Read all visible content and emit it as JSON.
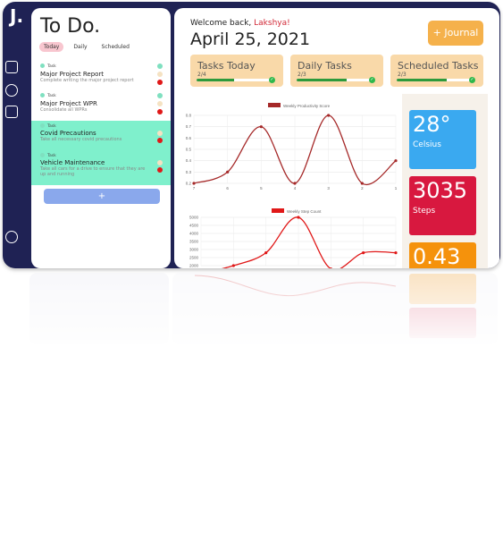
{
  "app": {
    "logo": "J."
  },
  "todo": {
    "title": "To Do.",
    "tabs": [
      {
        "label": "Today",
        "active": true
      },
      {
        "label": "Daily",
        "active": false
      },
      {
        "label": "Scheduled",
        "active": false
      }
    ],
    "tasks": [
      {
        "tag": "Task",
        "name": "Major Project Report",
        "desc": "Complete writing the major project report",
        "highlight": false
      },
      {
        "tag": "Task",
        "name": "Major Project WPR",
        "desc": "Consolidate all WPRs",
        "highlight": false
      },
      {
        "tag": "Task",
        "name": "Covid Precautions",
        "desc": "Take all necessary covid precautions",
        "highlight": true
      },
      {
        "tag": "Task",
        "name": "Vehicle Maintenance",
        "desc": "Take all cars for a drive to ensure that they are up and running",
        "highlight": true
      }
    ],
    "add_label": "+"
  },
  "header": {
    "welcome": "Welcome back, ",
    "user": "Lakshya!",
    "date": "April 25, 2021",
    "journal_label": "+ Journal"
  },
  "stats": [
    {
      "name": "Tasks Today",
      "count": "2/4",
      "progress": 0.5
    },
    {
      "name": "Daily Tasks",
      "count": "2/3",
      "progress": 0.67
    },
    {
      "name": "Scheduled Tasks",
      "count": "2/3",
      "progress": 0.67
    }
  ],
  "cards": [
    {
      "value": "28°",
      "unit": "Celsius",
      "color": "#3aa9f0"
    },
    {
      "value": "3035",
      "unit": "Steps",
      "color": "#d8183f"
    },
    {
      "value": "0.43",
      "unit": "",
      "color": "#f5920c"
    }
  ],
  "colors": {
    "accent_red": "#d12a38",
    "line_red": "#a52828",
    "task_highlight": "#7ff0cc"
  },
  "chart_data": [
    {
      "type": "line",
      "title": "",
      "legend": "Weekly Productivity Score",
      "x": [
        "7",
        "6",
        "5",
        "4",
        "3",
        "2",
        "1"
      ],
      "values": [
        0.2,
        0.3,
        0.7,
        0.2,
        0.8,
        0.2,
        0.4
      ],
      "ylim": [
        0.2,
        0.8
      ],
      "yticks": [
        "0.8",
        "0.7",
        "0.6",
        "0.5",
        "0.4",
        "0.3",
        "0.2"
      ]
    },
    {
      "type": "line",
      "title": "",
      "legend": "Weekly Step Count",
      "x": [
        "7",
        "6",
        "5",
        "4",
        "3",
        "2",
        "1"
      ],
      "values": [
        1500,
        2000,
        2800,
        5000,
        1800,
        2800,
        2800
      ],
      "ylim": [
        2000,
        5000
      ],
      "yticks": [
        "5000",
        "4500",
        "4000",
        "3500",
        "3000",
        "2500",
        "2000"
      ]
    }
  ]
}
